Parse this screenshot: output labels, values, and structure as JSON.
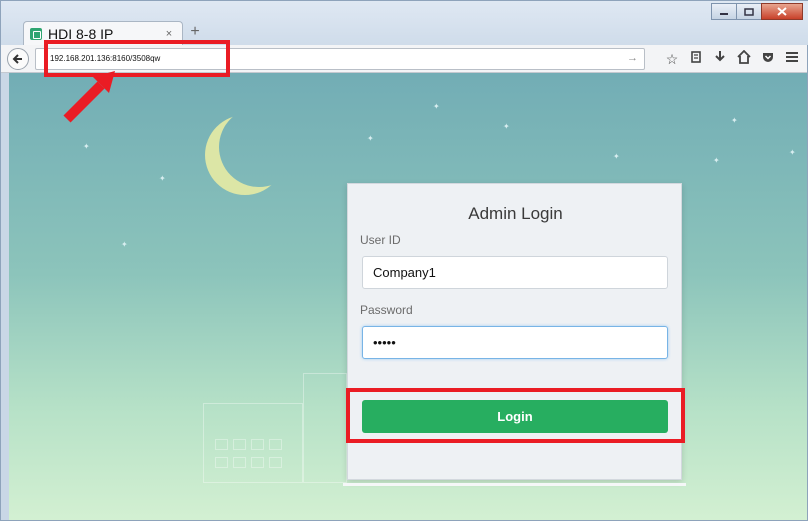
{
  "browser": {
    "tab_title": "HDI 8-8 IP",
    "tab_close": "×",
    "new_tab": "+",
    "url": "192.168.201.136:8160/3508qw",
    "back": "🡐",
    "go": "→",
    "toolbar_icons": [
      "star-icon",
      "reading-list-icon",
      "download-icon",
      "home-icon",
      "pocket-icon",
      "menu-icon"
    ],
    "window_controls": [
      "minimize",
      "maximize",
      "close"
    ]
  },
  "login": {
    "title": "Admin Login",
    "user_label": "User ID",
    "user_value": "Company1",
    "password_label": "Password",
    "password_value": "•••••",
    "button_label": "Login"
  },
  "colors": {
    "annotation": "#ea1c24",
    "login_button": "#27ae60",
    "moon": "#dce6a6"
  }
}
